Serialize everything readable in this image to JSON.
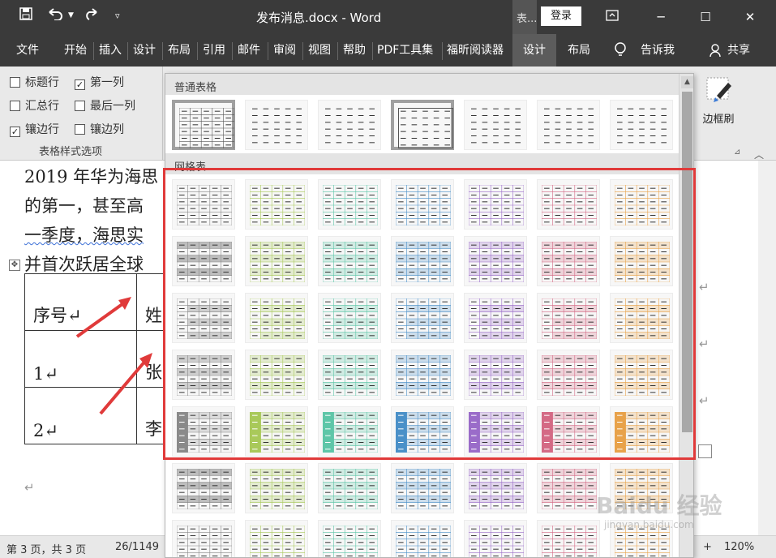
{
  "app": {
    "title": "发布消息.docx - Word",
    "search_text": "表...",
    "login_label": "登录"
  },
  "window_controls": {
    "ribbon_display_icon": "ribbon-display-icon",
    "minimize": "─",
    "maximize": "☐",
    "close": "✕"
  },
  "quick_access": {
    "save_icon": "save-icon",
    "undo_icon": "undo-icon",
    "redo_icon": "redo-icon",
    "customize_icon": "customize-qat-icon"
  },
  "tabs": [
    {
      "label": "文件"
    },
    {
      "label": "开始"
    },
    {
      "label": "插入"
    },
    {
      "label": "设计"
    },
    {
      "label": "布局"
    },
    {
      "label": "引用"
    },
    {
      "label": "邮件"
    },
    {
      "label": "审阅"
    },
    {
      "label": "视图"
    },
    {
      "label": "帮助"
    },
    {
      "label": "PDF工具集"
    },
    {
      "label": "福昕阅读器"
    },
    {
      "label": "设计"
    },
    {
      "label": "布局"
    }
  ],
  "tell_me": "告诉我",
  "share": "共享",
  "table_style_options": {
    "group_label": "表格样式选项",
    "options": [
      {
        "label": "标题行",
        "checked": false
      },
      {
        "label": "第一列",
        "checked": true
      },
      {
        "label": "汇总行",
        "checked": false
      },
      {
        "label": "最后一列",
        "checked": false
      },
      {
        "label": "镶边行",
        "checked": true
      },
      {
        "label": "镶边列",
        "checked": false
      }
    ]
  },
  "border_painter": {
    "label": "边框刷"
  },
  "gallery": {
    "section_plain": "普通表格",
    "section_grid": "网格表"
  },
  "document": {
    "lines": [
      "2019 年华为海思",
      "的第一，甚至高",
      "一季度，海思实",
      "并首次跃居全球"
    ],
    "table": {
      "rows": [
        [
          "序号↵",
          "姓"
        ],
        [
          "1↵",
          "张"
        ],
        [
          "2↵",
          "李"
        ]
      ]
    },
    "empty_para": "↵"
  },
  "status": {
    "page": "第 3 页，共 3 页",
    "words": "26/1149",
    "zoom": "120%"
  },
  "watermark": {
    "brand": "Baidu 经验",
    "url": "jingyan.baidu.com"
  },
  "colors": {
    "titlebar": "#3a3a3a",
    "highlight": "#e03a3a",
    "grid_palette": [
      "#8a8a8a",
      "#a9c95a",
      "#5ec6a8",
      "#4a90c8",
      "#9a6cc9",
      "#d46a85",
      "#e8a24a"
    ]
  }
}
